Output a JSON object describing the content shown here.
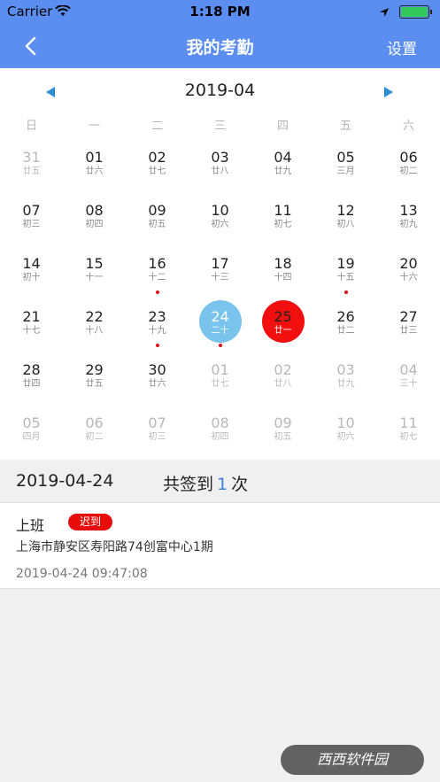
{
  "status_bar": {
    "carrier": "Carrier",
    "time": "1:18 PM"
  },
  "nav": {
    "title": "我的考勤",
    "settings_label": "设置"
  },
  "calendar": {
    "month_label": "2019-04",
    "weekdays": [
      "日",
      "一",
      "二",
      "三",
      "四",
      "五",
      "六"
    ],
    "days": [
      {
        "num": "31",
        "lunar": "廿五",
        "other": true
      },
      {
        "num": "01",
        "lunar": "廿六"
      },
      {
        "num": "02",
        "lunar": "廿七"
      },
      {
        "num": "03",
        "lunar": "廿八"
      },
      {
        "num": "04",
        "lunar": "廿九"
      },
      {
        "num": "05",
        "lunar": "三月"
      },
      {
        "num": "06",
        "lunar": "初二"
      },
      {
        "num": "07",
        "lunar": "初三"
      },
      {
        "num": "08",
        "lunar": "初四"
      },
      {
        "num": "09",
        "lunar": "初五"
      },
      {
        "num": "10",
        "lunar": "初六"
      },
      {
        "num": "11",
        "lunar": "初七"
      },
      {
        "num": "12",
        "lunar": "初八"
      },
      {
        "num": "13",
        "lunar": "初九"
      },
      {
        "num": "14",
        "lunar": "初十"
      },
      {
        "num": "15",
        "lunar": "十一"
      },
      {
        "num": "16",
        "lunar": "十二",
        "dot": true
      },
      {
        "num": "17",
        "lunar": "十三"
      },
      {
        "num": "18",
        "lunar": "十四"
      },
      {
        "num": "19",
        "lunar": "十五",
        "dot": true
      },
      {
        "num": "20",
        "lunar": "十六"
      },
      {
        "num": "21",
        "lunar": "十七"
      },
      {
        "num": "22",
        "lunar": "十八"
      },
      {
        "num": "23",
        "lunar": "十九",
        "dot": true
      },
      {
        "num": "24",
        "lunar": "二十",
        "today": true,
        "dot": true
      },
      {
        "num": "25",
        "lunar": "廿一",
        "selected": true
      },
      {
        "num": "26",
        "lunar": "廿二"
      },
      {
        "num": "27",
        "lunar": "廿三"
      },
      {
        "num": "28",
        "lunar": "廿四"
      },
      {
        "num": "29",
        "lunar": "廿五"
      },
      {
        "num": "30",
        "lunar": "廿六"
      },
      {
        "num": "01",
        "lunar": "廿七",
        "other": true
      },
      {
        "num": "02",
        "lunar": "廿八",
        "other": true
      },
      {
        "num": "03",
        "lunar": "廿九",
        "other": true
      },
      {
        "num": "04",
        "lunar": "三十",
        "other": true
      },
      {
        "num": "05",
        "lunar": "四月",
        "other": true
      },
      {
        "num": "06",
        "lunar": "初二",
        "other": true
      },
      {
        "num": "07",
        "lunar": "初三",
        "other": true
      },
      {
        "num": "08",
        "lunar": "初四",
        "other": true
      },
      {
        "num": "09",
        "lunar": "初五",
        "other": true
      },
      {
        "num": "10",
        "lunar": "初六",
        "other": true
      },
      {
        "num": "11",
        "lunar": "初七",
        "other": true
      }
    ]
  },
  "summary": {
    "date": "2019-04-24",
    "count_prefix": "共签到",
    "count": "1",
    "count_suffix": "次"
  },
  "record": {
    "type": "上班",
    "badge": "迟到",
    "address": "上海市静安区寿阳路74创富中心1期",
    "time": "2019-04-24 09:47:08"
  },
  "watermark": {
    "text": "西西软件园"
  },
  "colors": {
    "nav": "#5b8ef0",
    "today": "#7ac3ec",
    "selected": "#f10f0f",
    "dot": "#e01010",
    "count": "#3b83e0"
  }
}
